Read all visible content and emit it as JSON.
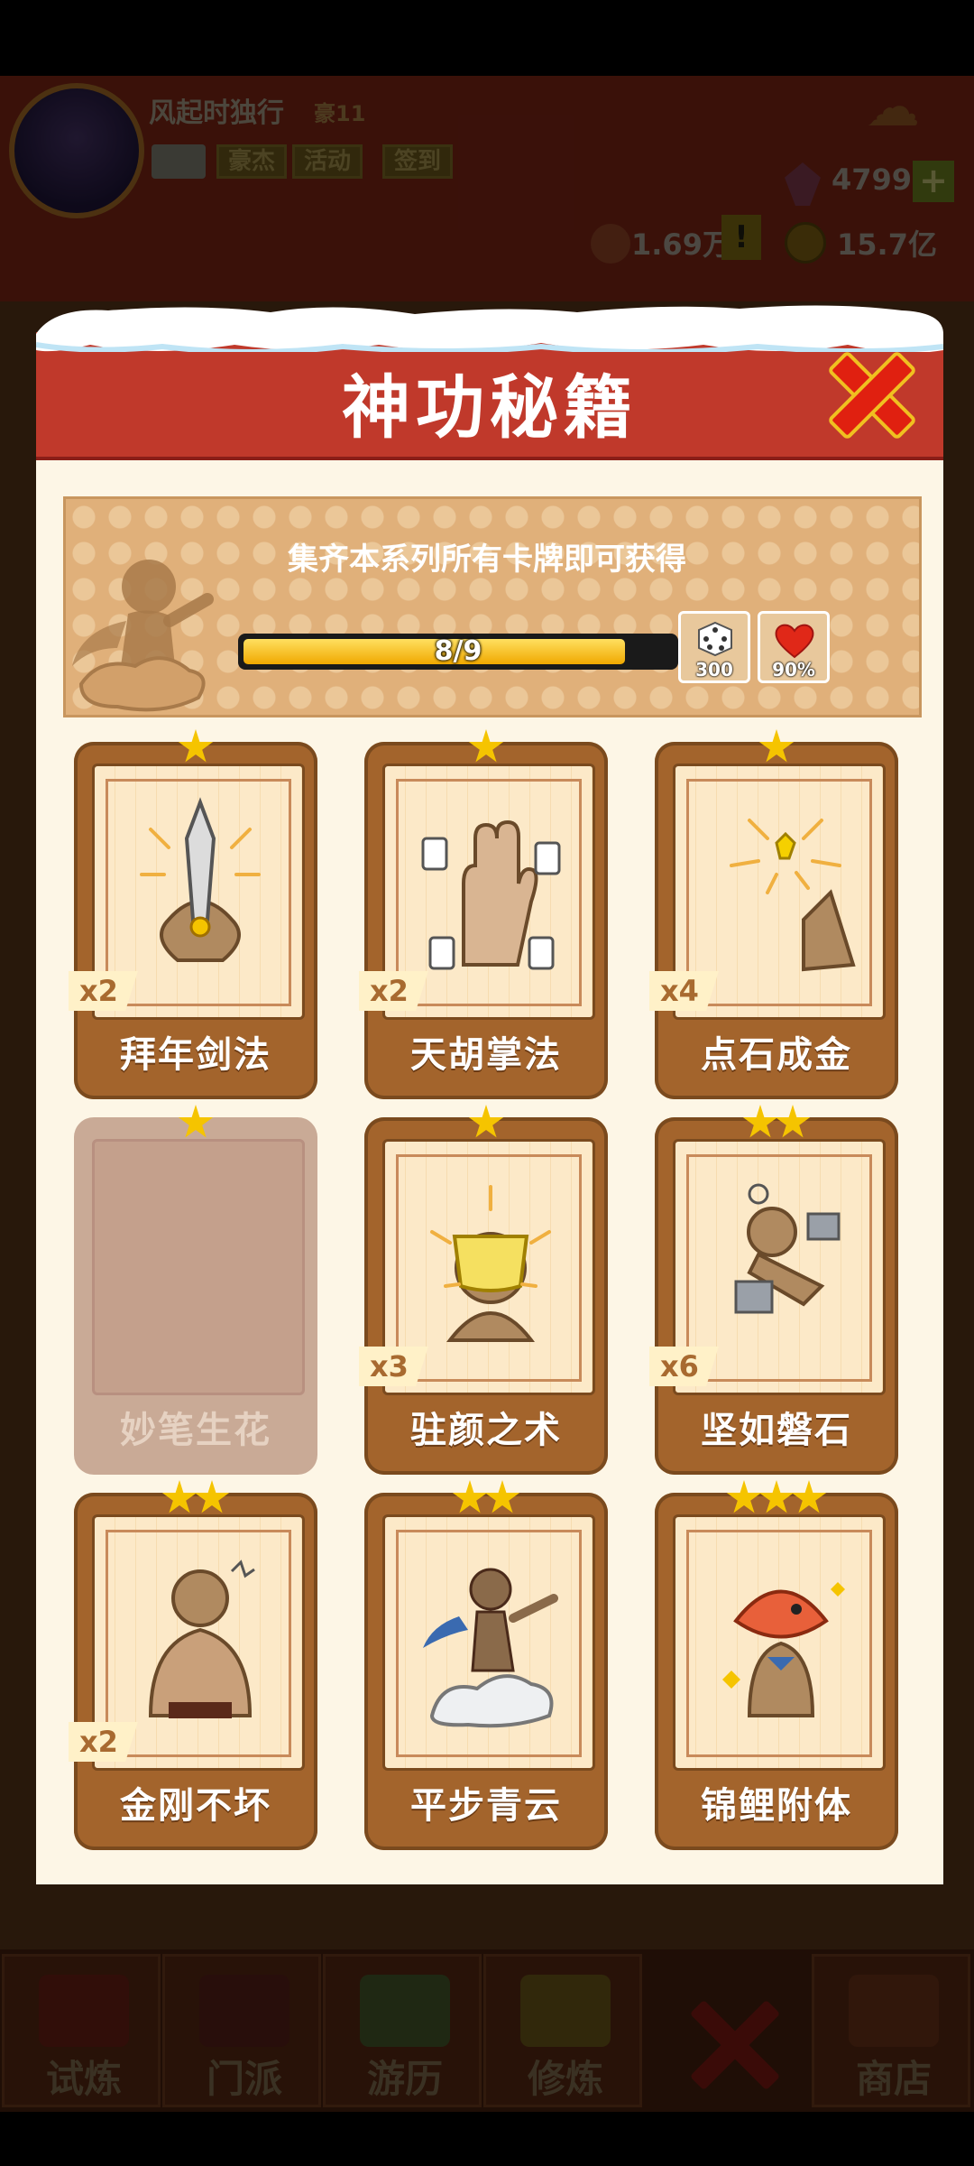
{
  "hud": {
    "player_name": "风起时独行",
    "player_level": "豪11",
    "buttons": [
      "豪杰",
      "活动",
      "签到"
    ],
    "gems": "4799",
    "gem_plus": "+",
    "tickets": "1.69万",
    "ticket_alert": "!",
    "coins": "15.7亿"
  },
  "modal": {
    "title": "神功秘籍",
    "banner_text": "集齐本系列所有卡牌即可获得",
    "progress": {
      "text": "8/9",
      "current": 8,
      "total": 9
    },
    "rewards": [
      {
        "icon": "dice-icon",
        "value": "300"
      },
      {
        "icon": "heart-icon",
        "value": "90%"
      }
    ],
    "cards": [
      {
        "name": "拜年剑法",
        "stars": 1,
        "multiplier": "x2",
        "locked": false,
        "art": "sword-icon"
      },
      {
        "name": "天胡掌法",
        "stars": 1,
        "multiplier": "x2",
        "locked": false,
        "art": "palm-icon"
      },
      {
        "name": "点石成金",
        "stars": 1,
        "multiplier": "x4",
        "locked": false,
        "art": "gold-finger-icon"
      },
      {
        "name": "妙笔生花",
        "stars": 1,
        "multiplier": "",
        "locked": true,
        "art": ""
      },
      {
        "name": "驻颜之术",
        "stars": 1,
        "multiplier": "x3",
        "locked": false,
        "art": "mask-icon"
      },
      {
        "name": "坚如磐石",
        "stars": 2,
        "multiplier": "x6",
        "locked": false,
        "art": "rock-body-icon"
      },
      {
        "name": "金刚不坏",
        "stars": 2,
        "multiplier": "x2",
        "locked": false,
        "art": "muscle-icon"
      },
      {
        "name": "平步青云",
        "stars": 2,
        "multiplier": "",
        "locked": false,
        "art": "cloud-rider-icon"
      },
      {
        "name": "锦鲤附体",
        "stars": 3,
        "multiplier": "",
        "locked": false,
        "art": "koi-head-icon"
      }
    ]
  },
  "nav": {
    "tabs": [
      "试炼",
      "门派",
      "游历",
      "修炼",
      "商店"
    ]
  },
  "colors": {
    "header_red": "#c0392b",
    "card_brown": "#a3642c",
    "star_gold": "#f5c400",
    "progress_gold": "#f0a800"
  }
}
